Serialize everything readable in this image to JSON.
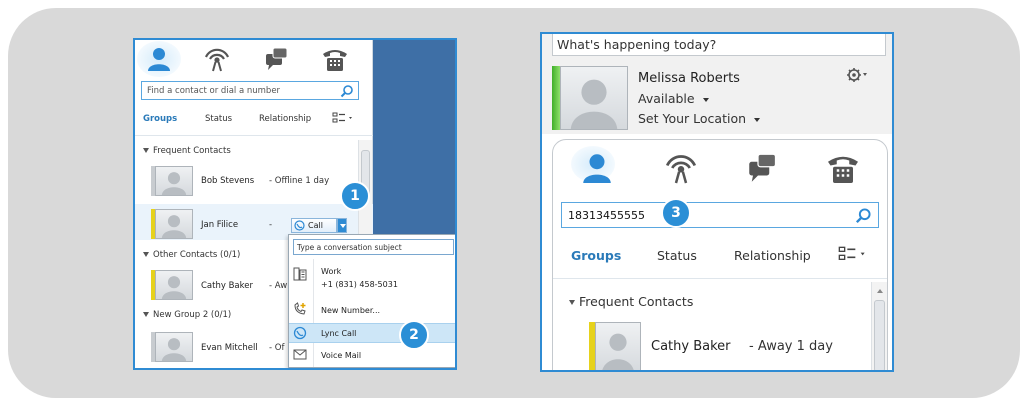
{
  "left": {
    "search": {
      "placeholder": "Find a contact or dial a number"
    },
    "tabs": {
      "groups": "Groups",
      "status": "Status",
      "relationship": "Relationship"
    },
    "groups": [
      {
        "label": "Frequent Contacts"
      },
      {
        "label": "Other Contacts (0/1)"
      },
      {
        "label": "New Group 2 (0/1)"
      }
    ],
    "contacts": [
      {
        "name": "Bob Stevens",
        "status": "- Offline 1 day"
      },
      {
        "name": "Jan Filice",
        "status": "-"
      },
      {
        "name": "Cathy Baker",
        "status": "- Aw"
      },
      {
        "name": "Evan Mitchell",
        "status": "- Of"
      }
    ],
    "call_button": "Call",
    "menu": {
      "subject_placeholder": "Type a conversation subject",
      "work_label": "Work",
      "work_number": "+1 (831) 458-5031",
      "new_number": "New Number...",
      "lync_call": "Lync Call",
      "voice_mail": "Voice Mail"
    },
    "badges": [
      "1",
      "2"
    ]
  },
  "right": {
    "whats_happening": "What's happening today?",
    "user_name": "Melissa Roberts",
    "availability": "Available",
    "location": "Set Your Location",
    "search_value": "18313455555",
    "tabs": {
      "groups": "Groups",
      "status": "Status",
      "relationship": "Relationship"
    },
    "group_label": "Frequent Contacts",
    "contact": {
      "name": "Cathy Baker",
      "status": "- Away 1 day"
    },
    "badge": "3"
  },
  "colors": {
    "accent": "#2f8bd3",
    "badge": "#2b8fd6",
    "presence_available": "#5cc83a",
    "presence_away": "#e6d21c",
    "presence_offline": "#c8ccd0",
    "navy": "#3e6fa6"
  },
  "icons": [
    "contacts-icon",
    "activity-feed-icon",
    "conversations-icon",
    "phone-icon",
    "search-icon",
    "gear-icon",
    "view-options-icon",
    "phone-work-icon",
    "new-number-icon",
    "lync-call-icon",
    "voice-mail-icon"
  ]
}
